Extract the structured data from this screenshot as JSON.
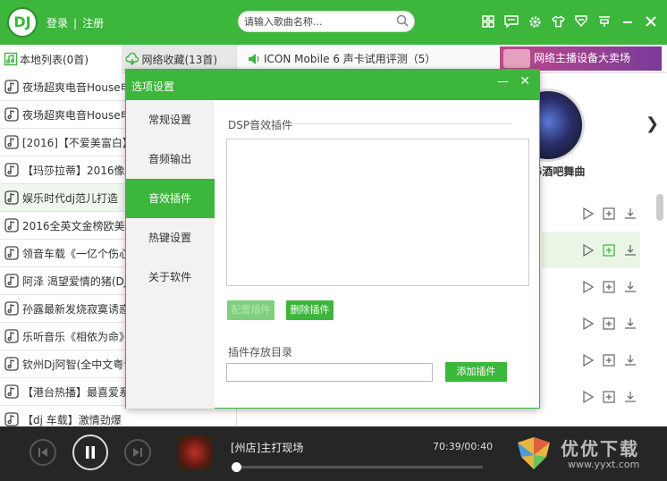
{
  "header": {
    "logo": "DJ",
    "login": "登录",
    "divider": "|",
    "register": "注册",
    "search_placeholder": "请输入歌曲名称...",
    "icons": [
      "grid-icon",
      "comment-icon",
      "gear-icon",
      "skin-icon",
      "download-icon",
      "mini-mode-icon",
      "minimize-icon",
      "close-icon"
    ]
  },
  "left": {
    "tab_local": "本地列表(0首)",
    "tab_net": "网络收藏(13首)",
    "songs": [
      "夜场超爽电音House电",
      "夜场超爽电音House电",
      "[2016]【不爱美富白】",
      "【玛莎拉蒂】2016像我",
      "娱乐时代dj范儿打造【",
      "2016全英文金榜欧美回",
      "领音车载《一亿个伤心",
      "阿泽 渴望爱情的猪(DJ",
      "孙露最新发烧寂寞诱惑",
      "乐听音乐《相依为命》",
      "钦州Dj阿智(全中文粤语",
      "【港台热播】最喜爱系",
      "【dj 车载】激情劲爆"
    ]
  },
  "right": {
    "title": "ICON Mobile 6 声卡试用评测（5）",
    "banner": "网络主播设备大卖场",
    "pic_title": "6酒吧舞曲"
  },
  "dialog": {
    "title": "选项设置",
    "minimize": "—",
    "close": "✕",
    "nav": [
      "常规设置",
      "音频输出",
      "音效插件",
      "热键设置",
      "关于软件"
    ],
    "active_nav": 2,
    "dsp_label": "DSP音效插件",
    "btn_config": "配置插件",
    "btn_delete": "删除插件",
    "dir_label": "插件存放目录",
    "dir_value": "",
    "btn_add": "添加插件"
  },
  "player": {
    "title": "[州店]主打现场",
    "time": "70:39/00:40",
    "progress": 0
  },
  "watermark": {
    "name": "优优下载",
    "url": "www.yyxt.com"
  },
  "colors": {
    "accent": "#3cb63b",
    "player_bg": "#262626"
  }
}
